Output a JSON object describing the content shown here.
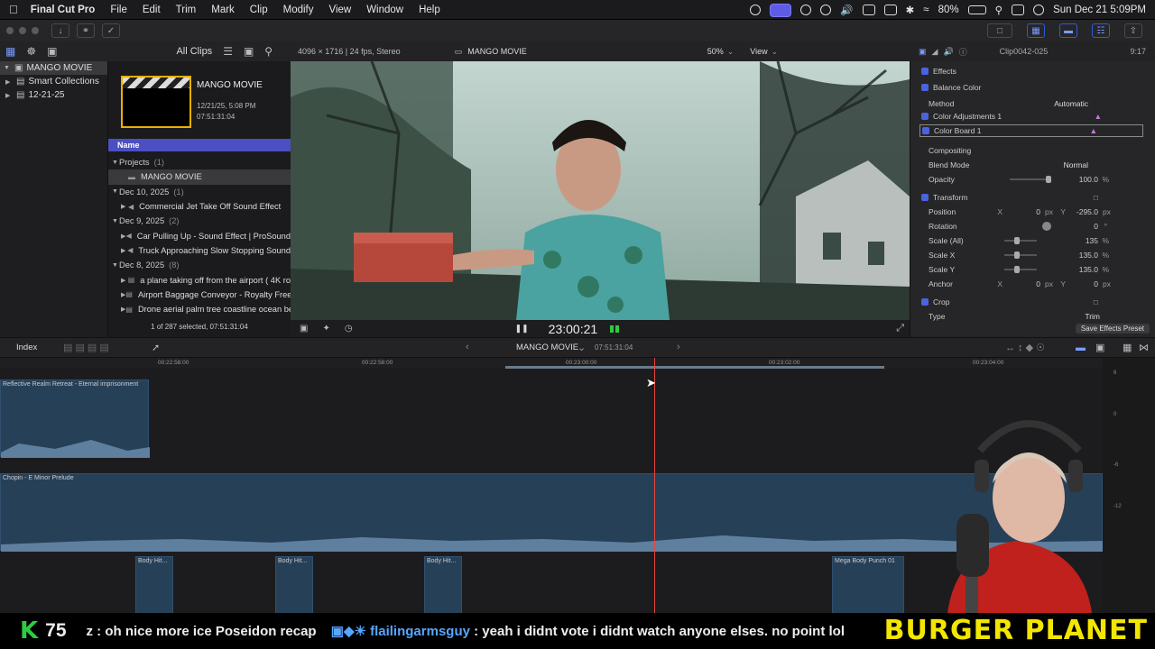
{
  "menubar": {
    "app": "Final Cut Pro",
    "items": [
      "File",
      "Edit",
      "Trim",
      "Mark",
      "Clip",
      "Modify",
      "View",
      "Window",
      "Help"
    ],
    "battery": "80%",
    "clock": "Sun Dec 21  5:09PM"
  },
  "library": {
    "filter": "All Clips",
    "root": "MANGO MOVIE",
    "items": [
      "Smart Collections",
      "12-21-25"
    ]
  },
  "browser": {
    "project_title": "MANGO MOVIE",
    "project_date": "12/21/25, 5:08 PM",
    "project_duration": "07:51:31:04",
    "column_header": "Name",
    "groups": [
      {
        "label": "Projects",
        "count": "(1)",
        "items": [
          "MANGO MOVIE"
        ]
      },
      {
        "label": "Dec 10, 2025",
        "count": "(1)",
        "items": [
          "Commercial Jet Take Off Sound Effect"
        ]
      },
      {
        "label": "Dec 9, 2025",
        "count": "(2)",
        "items": [
          "Car Pulling Up - Sound Effect  |  ProSound",
          "Truck Approaching Slow Stopping Sound"
        ]
      },
      {
        "label": "Dec 8, 2025",
        "count": "(8)",
        "items": [
          "a plane taking off from the airport ( 4K ro",
          "Airport Baggage Conveyor - Royalty Free",
          "Drone aerial palm tree coastline ocean be"
        ]
      }
    ],
    "status": "1 of 287 selected, 07:51:31:04"
  },
  "viewer": {
    "format": "4096 × 1716 | 24 fps, Stereo",
    "title": "MANGO MOVIE",
    "zoom": "50%",
    "view": "View",
    "timecode": "23:00:21"
  },
  "inspector": {
    "clip": "Clip0042-025",
    "duration": "9:17",
    "section_effects": "Effects",
    "balance_color": "Balance Color",
    "method_label": "Method",
    "method_value": "Automatic",
    "color_adjust": "Color Adjustments 1",
    "color_board": "Color Board 1",
    "compositing": "Compositing",
    "blend_label": "Blend Mode",
    "blend_value": "Normal",
    "opacity_label": "Opacity",
    "opacity_value": "100.0",
    "opacity_unit": "%",
    "transform": "Transform",
    "position_label": "Position",
    "pos_x_axis": "X",
    "pos_x": "0",
    "pos_x_unit": "px",
    "pos_y_axis": "Y",
    "pos_y": "-295.0",
    "pos_y_unit": "px",
    "rotation_label": "Rotation",
    "rotation_value": "0",
    "rotation_unit": "°",
    "scale_all_label": "Scale (All)",
    "scale_all_value": "135",
    "scale_all_unit": "%",
    "scale_x_label": "Scale X",
    "scale_x_value": "135.0",
    "scale_x_unit": "%",
    "scale_y_label": "Scale Y",
    "scale_y_value": "135.0",
    "scale_y_unit": "%",
    "anchor_label": "Anchor",
    "anchor_x_axis": "X",
    "anchor_x": "0",
    "anchor_x_unit": "px",
    "anchor_y_axis": "Y",
    "anchor_y": "0",
    "anchor_y_unit": "px",
    "crop": "Crop",
    "type_label": "Type",
    "type_value": "Trim",
    "save_preset": "Save Effects Preset"
  },
  "timeline": {
    "index": "Index",
    "project": "MANGO MOVIE",
    "duration": "07:51:31:04",
    "ruler": [
      "00:22:58:00",
      "00:22:58:00",
      "00:23:00:00",
      "00:23:02:00",
      "00:23:04:00"
    ],
    "clips": [
      {
        "name": "Reflective Realm Retreat - Eternal imprisonment"
      },
      {
        "name": "Chopin - E Minor Prelude"
      },
      {
        "name": "Body Hit..."
      },
      {
        "name": "Body Hit..."
      },
      {
        "name": "Body Hit..."
      },
      {
        "name": "Mega Body Punch 01"
      }
    ],
    "meter_labels": [
      "6",
      "0",
      "-6",
      "-12"
    ]
  },
  "ticker": {
    "k": "K",
    "count": "75",
    "msg1": "z : oh nice more ice Poseidon recap",
    "user": "flailingarmsguy",
    "msg2": ": yeah i didnt vote i didnt watch anyone elses. no point lol",
    "brand": "BURGER PLANET"
  }
}
